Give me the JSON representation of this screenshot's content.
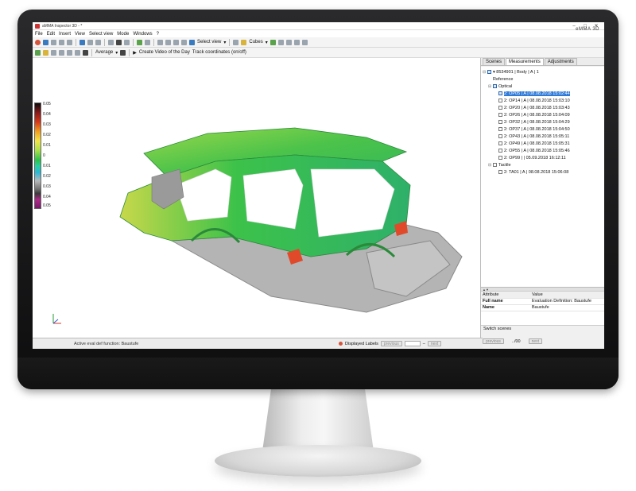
{
  "window": {
    "title": "aMMA Inspector 3D - *",
    "brand": "eMMA 3D"
  },
  "menu": [
    "File",
    "Edit",
    "Insert",
    "View",
    "Select view",
    "Mode",
    "Windows",
    "?"
  ],
  "toolbar1": {
    "select_view": "Select view",
    "cubes": "Cubes"
  },
  "toolbar2": {
    "average": "Average",
    "create_video": "Create Video of the Day",
    "track_coords": "Track coordinates (on/off)"
  },
  "scale": {
    "labels": [
      "0.05",
      "0.04",
      "0.03",
      "0.02",
      "0.01",
      "0",
      "0.01",
      "0.02",
      "0.03",
      "0.04",
      "0.05"
    ]
  },
  "panel": {
    "tabs": [
      "Scenes",
      "Measurements",
      "Adjustments"
    ],
    "tree": [
      {
        "indent": 0,
        "exp": "⊟",
        "checkbox": "on",
        "label": "▾ 8534901 | Body | A | 1"
      },
      {
        "indent": 1,
        "exp": "",
        "checkbox": "none",
        "label": "Reference"
      },
      {
        "indent": 1,
        "exp": "⊟",
        "checkbox": "on",
        "label": "Optical"
      },
      {
        "indent": 2,
        "exp": "",
        "checkbox": "on",
        "label": "2: OP05 | A | 08.08.2018 15:02:44",
        "selected": true
      },
      {
        "indent": 2,
        "exp": "",
        "checkbox": "off",
        "label": "2: OP14 | A | 08.08.2018 15:03:10"
      },
      {
        "indent": 2,
        "exp": "",
        "checkbox": "off",
        "label": "2: OP20 | A | 08.08.2018 15:03:43"
      },
      {
        "indent": 2,
        "exp": "",
        "checkbox": "off",
        "label": "2: OP26 | A | 08.08.2018 15:04:09"
      },
      {
        "indent": 2,
        "exp": "",
        "checkbox": "off",
        "label": "2: OP32 | A | 08.08.2018 15:04:29"
      },
      {
        "indent": 2,
        "exp": "",
        "checkbox": "off",
        "label": "2: OP37 | A | 08.08.2018 15:04:50"
      },
      {
        "indent": 2,
        "exp": "",
        "checkbox": "off",
        "label": "2: OP43 | A | 08.08.2018 15:05:11"
      },
      {
        "indent": 2,
        "exp": "",
        "checkbox": "off",
        "label": "2: OP49 | A | 08.08.2018 15:05:31"
      },
      {
        "indent": 2,
        "exp": "",
        "checkbox": "off",
        "label": "2: OP55 | A | 08.08.2018 15:05:46"
      },
      {
        "indent": 2,
        "exp": "",
        "checkbox": "off",
        "label": "2: OP99 | | 05.09.2018 16:12:11"
      },
      {
        "indent": 1,
        "exp": "⊟",
        "checkbox": "off",
        "label": "Tactile"
      },
      {
        "indent": 2,
        "exp": "",
        "checkbox": "off",
        "label": "2: TA01 | A | 08.08.2018 15:06:08"
      }
    ],
    "props_header": [
      "Attribute",
      "Value"
    ],
    "props": [
      {
        "key": "Full name",
        "value": "Evaluation Definition: Baustufe"
      },
      {
        "key": "Name",
        "value": "Baustufe"
      }
    ],
    "switch_title": "Switch scenes",
    "switch_prev": "previous",
    "switch_count": "../00",
    "switch_next": "next"
  },
  "status": {
    "eval_fn": "Active eval def function: Baustufe",
    "displayed_labels": "Displayed Labels",
    "prev": "previous",
    "sep": "–",
    "next": "next"
  },
  "colors": {
    "selection": "#2f7ad6",
    "car_green": "#3fc24a",
    "car_gray": "#a9a9a9"
  }
}
